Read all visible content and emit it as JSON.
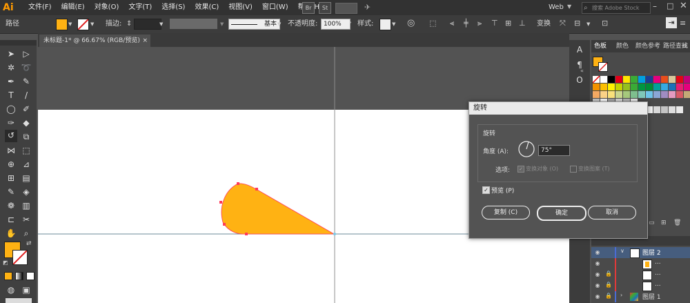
{
  "app": {
    "logo": "Ai",
    "menu": [
      "文件(F)",
      "编辑(E)",
      "对象(O)",
      "文字(T)",
      "选择(S)",
      "效果(C)",
      "视图(V)",
      "窗口(W)",
      "帮助(H)"
    ],
    "bridge_label": "Br",
    "stock_label": "St",
    "workspace": "Web",
    "search_placeholder": "搜索 Adobe Stock"
  },
  "control_bar": {
    "selection_label": "路径",
    "stroke_label": "描边:",
    "brush_label": "基本",
    "opacity_label": "不透明度:",
    "opacity_value": "100%",
    "style_label": "样式:",
    "transform_label": "变换"
  },
  "document": {
    "tab_title": "未标题-1* @ 66.67% (RGB/预览)",
    "close_label": "×"
  },
  "panel": {
    "tabs": [
      "色板",
      "颜色",
      "颜色参考",
      "路径查找"
    ],
    "menu_icon": "≡"
  },
  "layers": [
    {
      "name": "图层 2",
      "expanded": true
    },
    {
      "name": "...",
      "expanded": false
    },
    {
      "name": "...",
      "expanded": false
    },
    {
      "name": "...",
      "expanded": false
    },
    {
      "name": "图层 1",
      "expanded": false
    }
  ],
  "dialog": {
    "title": "旋转",
    "group_title": "旋转",
    "angle_label": "角度 (A):",
    "angle_value": "75°",
    "options_label": "选项:",
    "transform_objects": "变换对象 (O)",
    "transform_patterns": "变换图案 (T)",
    "preview_label": "预览 (P)",
    "copy_button": "复制 (C)",
    "ok_button": "确定",
    "cancel_button": "取消"
  },
  "colors": {
    "accent_fill": "#ffb213",
    "path_stroke": "#ff3a5a"
  }
}
